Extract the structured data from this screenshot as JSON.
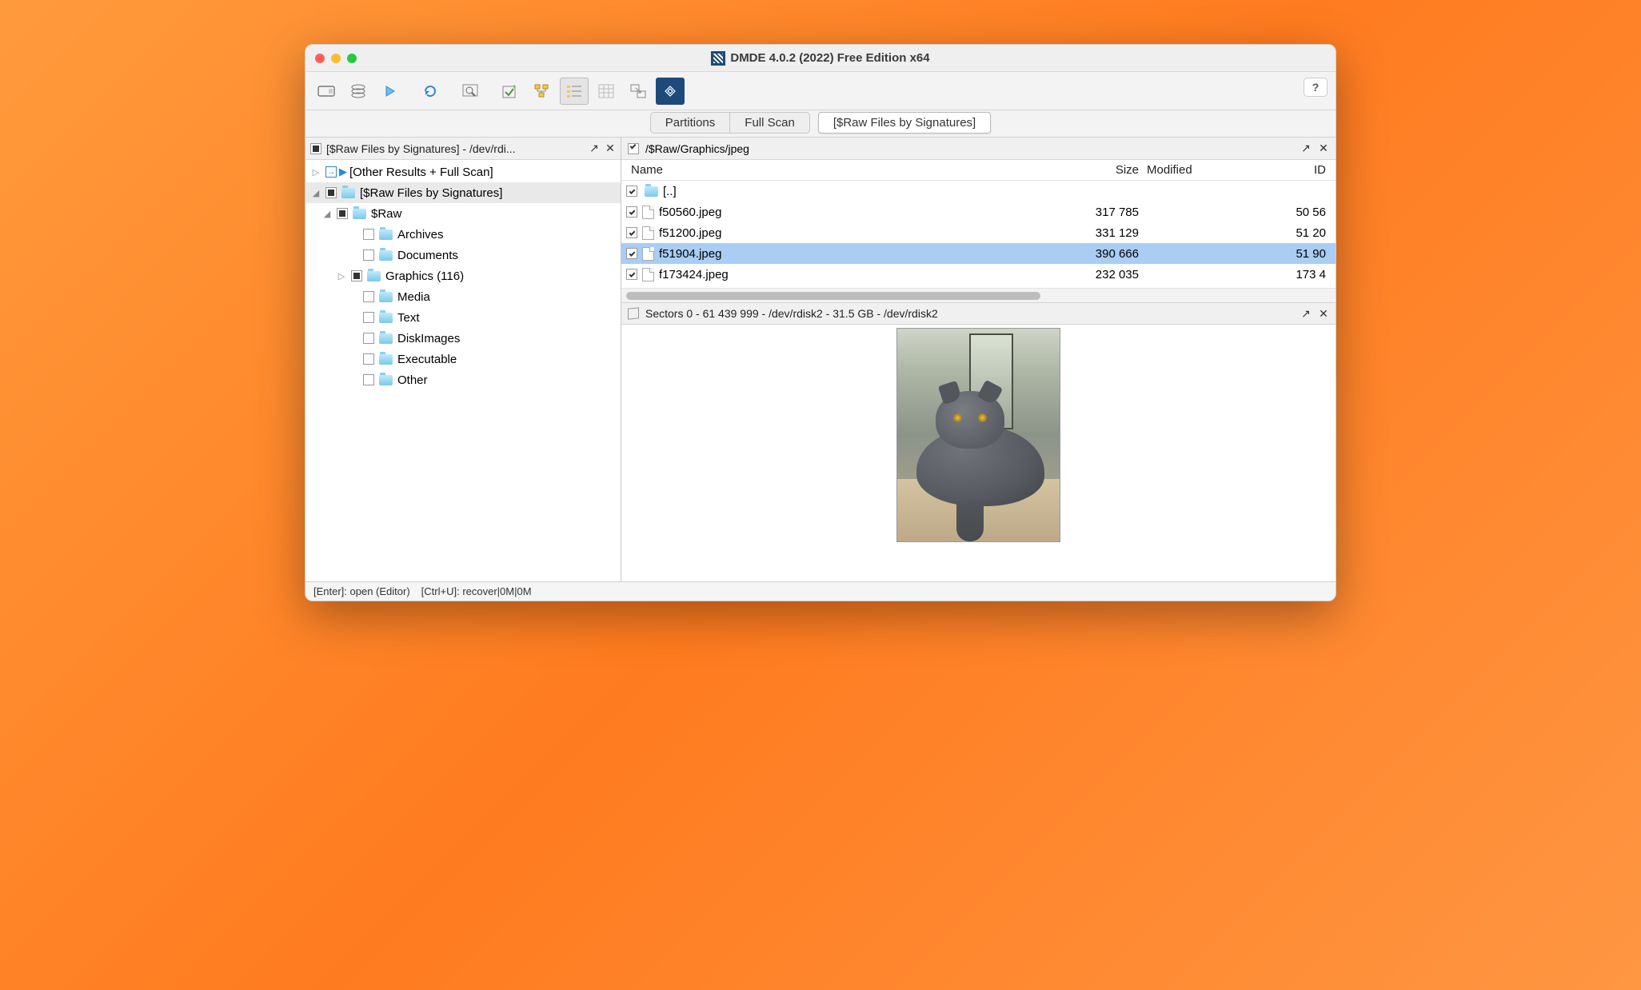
{
  "window": {
    "title": "DMDE 4.0.2 (2022) Free Edition x64"
  },
  "toolbar": {
    "help": "?"
  },
  "tabs": {
    "partitions": "Partitions",
    "fullscan": "Full Scan",
    "raw": "[$Raw Files by Signatures]"
  },
  "leftPanel": {
    "title": "[$Raw Files by Signatures] - /dev/rdi...",
    "rows": {
      "other": "[Other Results + Full Scan]",
      "rawsig": "[$Raw Files by Signatures]",
      "raw": "$Raw",
      "archives": "Archives",
      "documents": "Documents",
      "graphics": "Graphics (116)",
      "media": "Media",
      "text": "Text",
      "diskimages": "DiskImages",
      "executable": "Executable",
      "other2": "Other"
    }
  },
  "fileList": {
    "path": "/$Raw/Graphics/jpeg",
    "cols": {
      "name": "Name",
      "size": "Size",
      "modified": "Modified",
      "id": "ID"
    },
    "parent": "[..]",
    "rows": [
      {
        "name": "f50560.jpeg",
        "size": "317 785",
        "id": "50 56"
      },
      {
        "name": "f51200.jpeg",
        "size": "331 129",
        "id": "51 20"
      },
      {
        "name": "f51904.jpeg",
        "size": "390 666",
        "id": "51 90",
        "selected": true
      },
      {
        "name": "f173424.jpeg",
        "size": "232 035",
        "id": "173 4"
      }
    ]
  },
  "preview": {
    "title": "Sectors 0 - 61 439 999 - /dev/rdisk2 - 31.5 GB - /dev/rdisk2"
  },
  "status": {
    "a": "[Enter]: open (Editor)",
    "b": "[Ctrl+U]: recover|0M|0M"
  }
}
